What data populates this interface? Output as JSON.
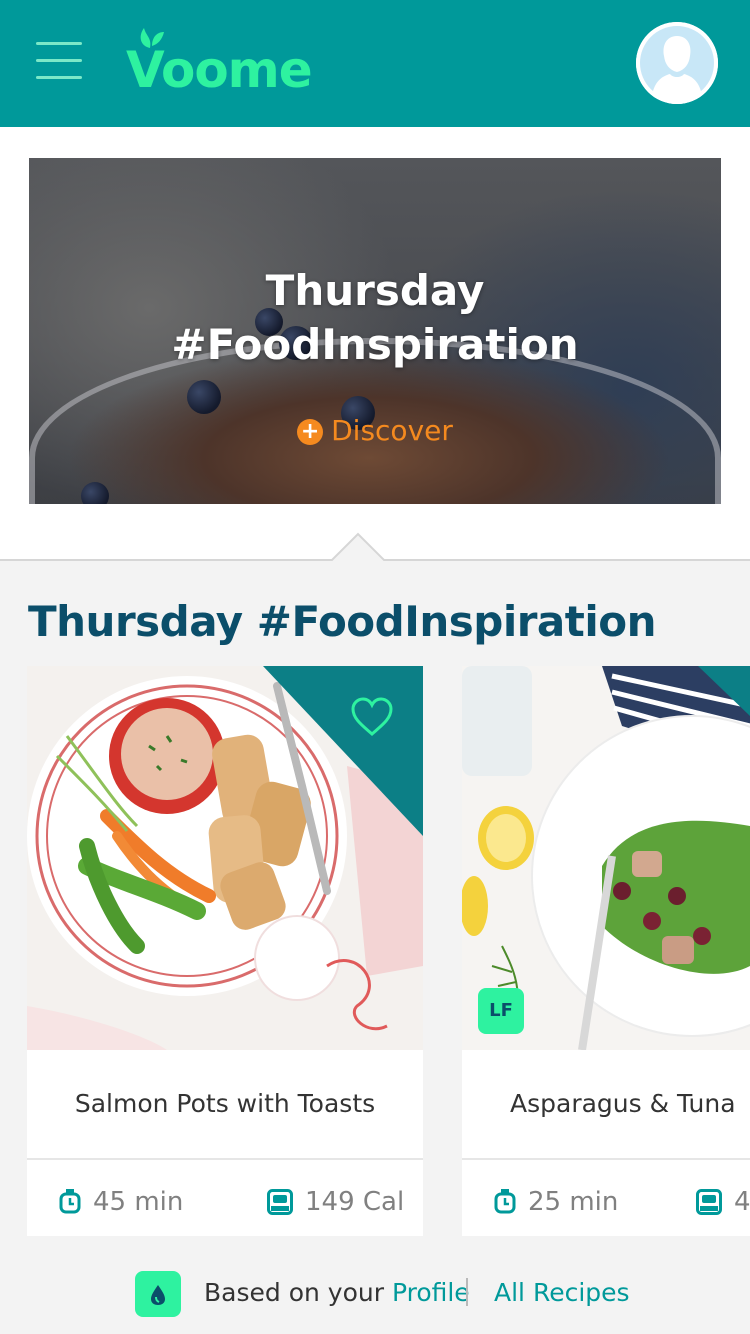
{
  "header": {
    "menu_icon": "hamburger-menu-icon",
    "logo_text": "Voome",
    "avatar_icon": "user-avatar-icon",
    "brand_color": "#00999a",
    "accent_color": "#2ef2a0"
  },
  "hero": {
    "title_line1": "Thursday",
    "title_line2": "#FoodInspiration",
    "cta_label": "Discover",
    "cta_icon": "plus-circle-icon",
    "cta_color": "#f58a1f"
  },
  "section": {
    "title": "Thursday #FoodInspiration",
    "title_color": "#0b4e6a"
  },
  "recipes": [
    {
      "name": "Salmon Pots with Toasts",
      "time": "45 min",
      "calories": "149 Cal",
      "favorite_icon": "heart-outline-icon"
    },
    {
      "name": "Asparagus & Tuna",
      "time": "25 min",
      "calories": "4",
      "badge": "LF"
    }
  ],
  "footer": {
    "badge_icon": "drop-icon",
    "based_on_text": "Based on your ",
    "profile_link": "Profile",
    "all_recipes_link": "All Recipes"
  }
}
